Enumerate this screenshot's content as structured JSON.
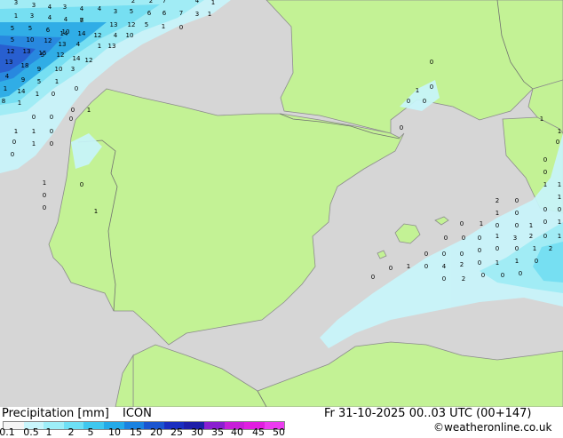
{
  "map": {
    "colors": {
      "sea": "#d6d6d6",
      "land": "#c3f295",
      "land_outside_domain": "#a6d97d",
      "coastline": "#8c8c8c",
      "border": "#707070",
      "value_text": "#000000"
    },
    "precip_values_visible": [
      "3",
      "3",
      "4",
      "3",
      "4",
      "4",
      "2",
      "2",
      "7",
      "4",
      "1",
      "1",
      "3",
      "4",
      "4",
      "8",
      "3",
      "5",
      "6",
      "6",
      "7",
      "3",
      "1",
      "5",
      "5",
      "6",
      "10",
      "7",
      "13",
      "12",
      "5",
      "1",
      "0",
      "5",
      "10",
      "12",
      "14",
      "14",
      "12",
      "4",
      "10",
      "12",
      "13",
      "15",
      "13",
      "4",
      "1",
      "13",
      "13",
      "18",
      "5",
      "12",
      "14",
      "12",
      "4",
      "9",
      "9",
      "10",
      "3",
      "1",
      "14",
      "5",
      "1",
      "0",
      "8",
      "1",
      "1",
      "0",
      "0",
      "1",
      "0",
      "0",
      "0",
      "1",
      "1",
      "0",
      "0",
      "1",
      "0",
      "0",
      "1",
      "0",
      "0",
      "0",
      "1",
      "0",
      "1",
      "0",
      "0",
      "0",
      "0",
      "1",
      "1",
      "0",
      "0",
      "0",
      "1",
      "1",
      "1",
      "2",
      "0",
      "1",
      "0",
      "0",
      "0",
      "0",
      "1",
      "0",
      "0",
      "1",
      "0",
      "1",
      "0",
      "0",
      "0",
      "1",
      "3",
      "2",
      "0",
      "1",
      "0",
      "0",
      "0",
      "0",
      "0",
      "0",
      "1",
      "2",
      "1",
      "0",
      "4",
      "2",
      "0",
      "1",
      "1",
      "0",
      "0",
      "0",
      "0",
      "2",
      "0",
      "0",
      "0"
    ]
  },
  "footer": {
    "title": "Precipitation [mm]",
    "model": "ICON",
    "datetime": "Fr 31-10-2025 00..03 UTC (00+147)",
    "credit": "©weatheronline.co.uk",
    "legend": {
      "ticks": [
        "0.1",
        "0.5",
        "1",
        "2",
        "5",
        "10",
        "15",
        "20",
        "25",
        "30",
        "35",
        "40",
        "45",
        "50"
      ],
      "colors": [
        "#f5f5f5",
        "#c8f5fb",
        "#9deef8",
        "#6ee0f5",
        "#3fc8ef",
        "#23aae8",
        "#1a82e0",
        "#1a55d0",
        "#1a2ec0",
        "#1e1ea8",
        "#8a1ed0",
        "#c71ed8",
        "#e01ee0",
        "#ec3cf0"
      ]
    }
  }
}
